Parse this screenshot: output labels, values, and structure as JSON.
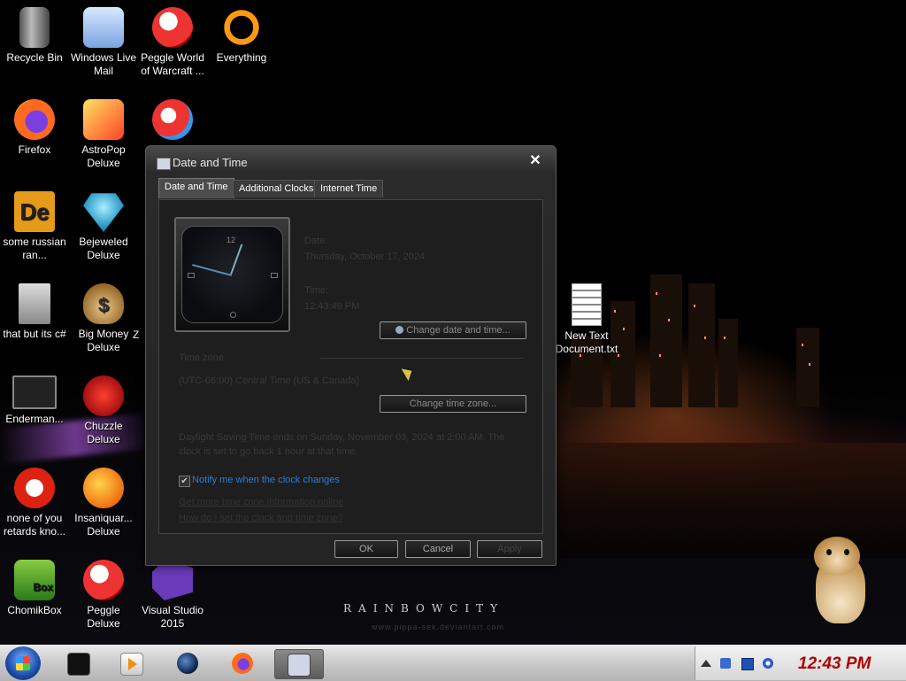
{
  "desktop": {
    "icons": [
      {
        "label": "Recycle Bin",
        "icon": "recycle-bin-icon"
      },
      {
        "label": "Windows Live Mail",
        "icon": "mail-icon"
      },
      {
        "label": "Peggle World of Warcraft ...",
        "icon": "peggle-icon"
      },
      {
        "label": "Everything",
        "icon": "search-icon"
      },
      {
        "label": "Firefox",
        "icon": "firefox-icon"
      },
      {
        "label": "AstroPop Deluxe",
        "icon": "astropop-icon"
      },
      {
        "label": "",
        "icon": "peggle-icon"
      },
      {
        "label": "some russian ran...",
        "icon": "de-icon"
      },
      {
        "label": "Bejeweled Deluxe",
        "icon": "gem-icon"
      },
      {
        "label": "that but its c#",
        "icon": "copy-icon"
      },
      {
        "label": "Big Money Deluxe",
        "icon": "money-bag-icon"
      },
      {
        "label": "Enderman...",
        "icon": "shortcut-icon"
      },
      {
        "label": "Chuzzle Deluxe",
        "icon": "chuzzle-icon"
      },
      {
        "label": "none of you retards kno...",
        "icon": "dragon-icon"
      },
      {
        "label": "Insaniquar... Deluxe",
        "icon": "fish-icon"
      },
      {
        "label": "ChomikBox",
        "icon": "chomikbox-icon"
      },
      {
        "label": "Peggle Deluxe",
        "icon": "peggle-icon"
      },
      {
        "label": "Visual Studio 2015",
        "icon": "visual-studio-icon"
      },
      {
        "label": "New Text Document.txt",
        "icon": "text-file-icon"
      }
    ],
    "partial_label": "Z",
    "de_glyph": "De",
    "money_glyph": "$",
    "box_glyph": "Box"
  },
  "wallpaper": {
    "brand": "RAINBOWCITY",
    "url": "www.pippa-sek.deviantart.com"
  },
  "dialog": {
    "title": "Date and Time",
    "close_glyph": "✕",
    "tabs": [
      "Date and Time",
      "Additional Clocks",
      "Internet Time"
    ],
    "date_label": "Date:",
    "date_value": "Thursday, October 17, 2024",
    "time_label": "Time:",
    "time_value": "12:43:49 PM",
    "change_datetime_button": "Change date and time...",
    "timezone_label": "Time zone",
    "timezone_value": "(UTC-06:00) Central Time (US & Canada)",
    "change_timezone_button": "Change time zone...",
    "dst_text_1": "Daylight Saving Time ends on Sunday, November 03, 2024 at 2:00 AM. The",
    "dst_text_2": "clock is set to go back 1 hour at that time.",
    "notify_label": "Notify me when the clock changes",
    "notify_checked": true,
    "link_timezone_info": "Get more time zone information online",
    "link_how_set": "How do I set the clock and time zone?",
    "ok_button": "OK",
    "cancel_button": "Cancel",
    "apply_button": "Apply",
    "clock_numeral_12": "12"
  },
  "taskbar": {
    "clock": "12:43 PM",
    "items": [
      "terminal-icon",
      "media-player-icon",
      "globe-icon",
      "firefox-icon",
      "date-time-icon"
    ],
    "active_item": "date-time-icon"
  },
  "colors": {
    "accent_link": "#2a7fd6",
    "clock_text": "#b00000"
  }
}
